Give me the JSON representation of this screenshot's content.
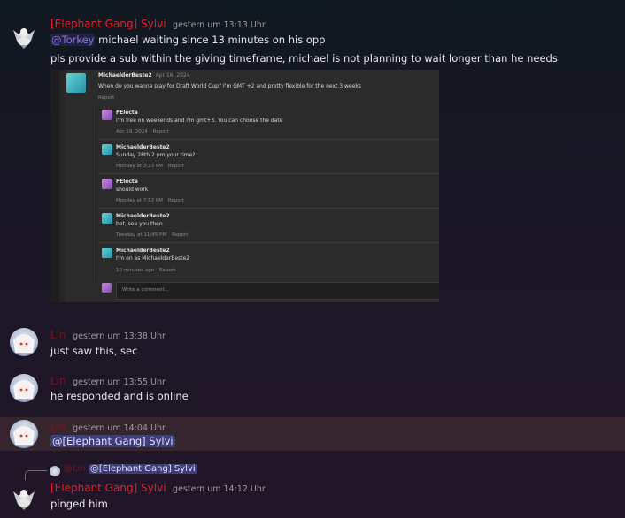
{
  "messages": {
    "m1": {
      "author": "[Elephant Gang] Sylvi",
      "timestamp": "gestern um 13:13 Uhr",
      "mention": "@Torkey",
      "line1": "michael waiting since 13 minutes on his opp",
      "line2": "pls provide a sub within the giving timeframe, michael is not planning to wait longer than he needs"
    },
    "m2": {
      "author": "Lin",
      "timestamp": "gestern um 13:38 Uhr",
      "text": "just saw this, sec"
    },
    "m3": {
      "author": "Lin",
      "timestamp": "gestern um 13:55 Uhr",
      "text": "he responded and is online"
    },
    "m4": {
      "author": "Lin",
      "timestamp": "gestern um 14:04 Uhr",
      "mention": "@[Elephant Gang] Sylvi"
    },
    "m5": {
      "reply_author": "@Lin",
      "reply_mention": "@[Elephant Gang] Sylvi",
      "author": "[Elephant Gang] Sylvi",
      "timestamp": "gestern um 14:12 Uhr",
      "text": "pinged him"
    }
  },
  "embed": {
    "post": {
      "author": "MichaelderBeste2",
      "date": "Apr 16, 2024",
      "text": "When do you wanna play for Draft World Cup? I'm GMT +2 and pretty flexible for the next 3 weeks",
      "report": "Report"
    },
    "replies": [
      {
        "author": "FElecta",
        "text": "i'm free on weekends and i'm gmt+3. You can choose the date",
        "time": "Apr 19, 2024",
        "report": "Report"
      },
      {
        "author": "MichaelderBeste2",
        "text": "Sunday 28th 2 pm your time?",
        "time": "Monday at 3:23 PM",
        "report": "Report"
      },
      {
        "author": "FElecta",
        "text": "should work",
        "time": "Monday at 7:52 PM",
        "report": "Report"
      },
      {
        "author": "MichaelderBeste2",
        "text": "bet, see you then",
        "time": "Tuesday at 11:45 PM",
        "report": "Report"
      },
      {
        "author": "MichaelderBeste2",
        "text": "I'm on as MichaelderBeste2",
        "time": "10 minutes ago",
        "report": "Report"
      }
    ],
    "comment_placeholder": "Write a comment..."
  }
}
